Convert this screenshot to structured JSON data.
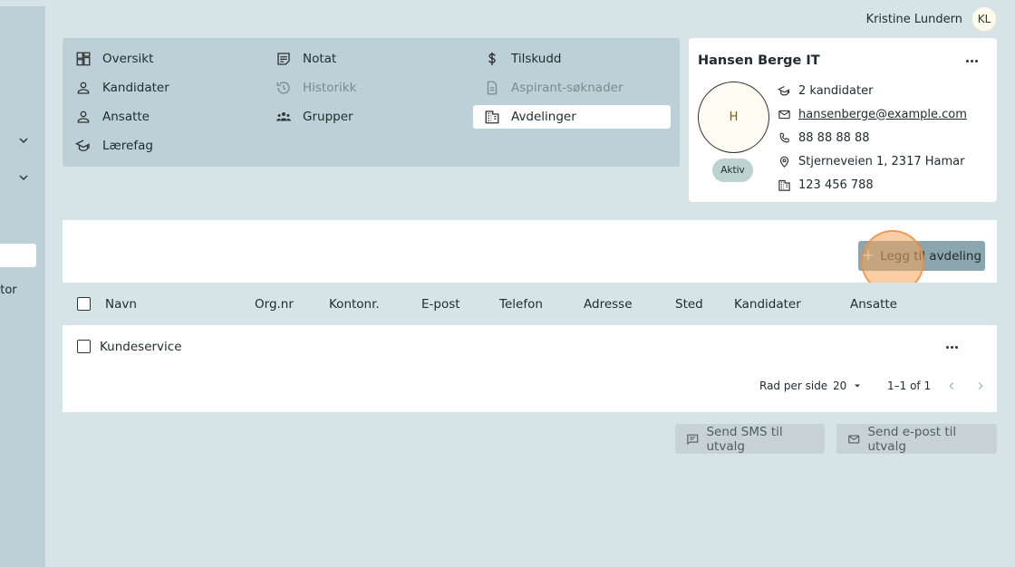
{
  "user": {
    "name": "Kristine Lundern",
    "initials": "KL"
  },
  "sidebar": {
    "partial_text": "ntor"
  },
  "nav": {
    "items": [
      {
        "label": "Oversikt",
        "icon": "dashboard-icon"
      },
      {
        "label": "Kandidater",
        "icon": "person-icon"
      },
      {
        "label": "Ansatte",
        "icon": "person-icon"
      },
      {
        "label": "Lærefag",
        "icon": "graduation-cap-icon"
      },
      {
        "label": "Notat",
        "icon": "note-icon"
      },
      {
        "label": "Historikk",
        "icon": "history-icon"
      },
      {
        "label": "Grupper",
        "icon": "groups-icon"
      },
      {
        "label": "Tilskudd",
        "icon": "dollar-icon"
      },
      {
        "label": "Aspirant-søknader",
        "icon": "document-icon"
      },
      {
        "label": "Avdelinger",
        "icon": "building-icon"
      }
    ]
  },
  "company": {
    "name": "Hansen Berge IT",
    "avatar_letter": "H",
    "status": "Aktiv",
    "candidates": "2 kandidater",
    "email": "hansenberge@example.com",
    "phone": "88 88 88 88",
    "address": "Stjerneveien 1, 2317 Hamar",
    "org_number": "123 456 788"
  },
  "table": {
    "add_button_label": "Legg til avdeling",
    "columns": [
      "Navn",
      "Org.nr",
      "Kontonr.",
      "E-post",
      "Telefon",
      "Adresse",
      "Sted",
      "Kandidater",
      "Ansatte"
    ],
    "rows": [
      {
        "name": "Kundeservice"
      }
    ],
    "pagination": {
      "rows_per_page_label": "Rad per side",
      "rows_per_page": "20",
      "range": "1–1 of 1"
    }
  },
  "footer": {
    "send_sms": "Send SMS til utvalg",
    "send_email": "Send e-post til utvalg"
  }
}
